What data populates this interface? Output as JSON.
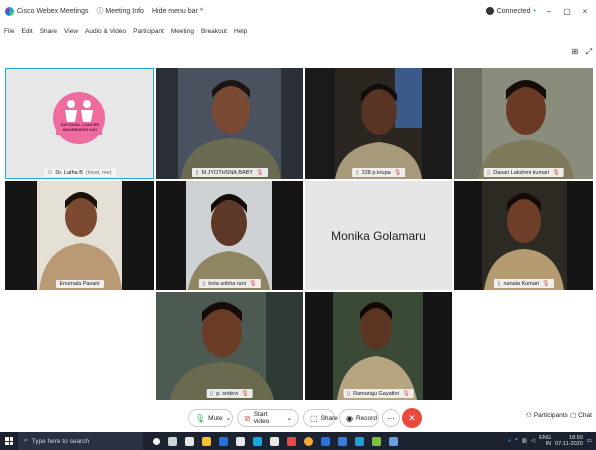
{
  "titlebar": {
    "app_title": "Cisco Webex Meetings",
    "meeting_info": "Meeting Info",
    "hide_menu": "Hide menu bar",
    "hide_menu_chevron": "^",
    "connected": "Connected",
    "connected_chevron": "•",
    "minimize": "–",
    "maximize": "▢",
    "close": "×"
  },
  "menu": [
    "File",
    "Edit",
    "Share",
    "View",
    "Audio & Video",
    "Participant",
    "Meeting",
    "Breakout",
    "Help"
  ],
  "layout_icons": [
    "grid-layout-icon",
    "expand-icon"
  ],
  "tiles": [
    {
      "name": "Dr. Latha B",
      "suffix": "(Host, me)",
      "logo": "NATIONAL CANCER AWARENESS DAY"
    },
    {
      "name": "M.JYOTHSNA BABY"
    },
    {
      "name": "228 p.krupa"
    },
    {
      "name": "Dasari Lakshmi kumari"
    },
    {
      "name": "Enumala Pavani"
    },
    {
      "name": "kota sobha rani"
    },
    {
      "name": "Monika Golamaru"
    },
    {
      "name": "nanala Kumari"
    },
    {
      "name": "p. sridevi"
    },
    {
      "name": "Ramaraju Gayathri"
    }
  ],
  "controls": {
    "mute": "Mute",
    "start_video": "Start video",
    "share": "Share",
    "record": "Record",
    "more": "···",
    "participants": "Participants",
    "chat": "Chat"
  },
  "taskbar": {
    "search_placeholder": "Type here to search",
    "lang": "ENG",
    "lang2": "IN",
    "time": "18:50",
    "date": "07-11-2020"
  },
  "colors": {
    "selected_outline": "#23a6e6",
    "end_call": "#e84b3c",
    "taskbar": "#1d2230",
    "mic_muted": "#e34c4c"
  }
}
